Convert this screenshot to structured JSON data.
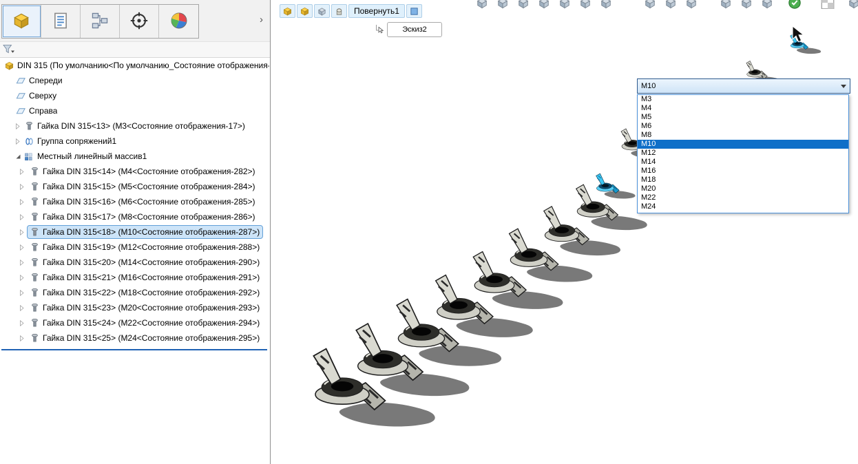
{
  "left_panel": {
    "tabs": [
      {
        "icon": "featuremanager-tree-icon"
      },
      {
        "icon": "propertymanager-icon"
      },
      {
        "icon": "configurationmanager-icon"
      },
      {
        "icon": "dimxpertmanager-icon"
      },
      {
        "icon": "displaymanager-icon"
      }
    ],
    "more_chevron": "›",
    "filter": {
      "icon": "filter-funnel-icon"
    },
    "tree": {
      "root_label": "DIN 315  (По умолчанию<По умолчанию_Состояние отображения-",
      "top_items": [
        {
          "icon": "plane-icon",
          "label": "Спереди"
        },
        {
          "icon": "plane-icon",
          "label": "Сверху"
        },
        {
          "icon": "plane-icon",
          "label": "Справа"
        },
        {
          "icon": "nut-part-icon",
          "label": "Гайка DIN 315<13>  (M3<Состояние отображения-17>)"
        },
        {
          "icon": "mates-group-icon",
          "label": "Группа сопряжений1"
        },
        {
          "icon": "linear-pattern-icon",
          "label": "Местный линейный массив1",
          "expanded": true
        }
      ],
      "pattern_children": [
        {
          "label": "Гайка DIN 315<14>  (M4<Состояние отображения-282>)"
        },
        {
          "label": "Гайка DIN 315<15>  (M5<Состояние отображения-284>)"
        },
        {
          "label": "Гайка DIN 315<16>  (M6<Состояние отображения-285>)"
        },
        {
          "label": "Гайка DIN 315<17>  (M8<Состояние отображения-286>)"
        },
        {
          "label": "Гайка DIN 315<18>  (M10<Состояние отображения-287>)",
          "selected": true
        },
        {
          "label": "Гайка DIN 315<19>  (M12<Состояние отображения-288>)"
        },
        {
          "label": "Гайка DIN 315<20>  (M14<Состояние отображения-290>)"
        },
        {
          "label": "Гайка DIN 315<21>  (M16<Состояние отображения-291>)"
        },
        {
          "label": "Гайка DIN 315<22>  (M18<Состояние отображения-292>)"
        },
        {
          "label": "Гайка DIN 315<23>  (M20<Состояние отображения-293>)"
        },
        {
          "label": "Гайка DIN 315<24>  (M22<Состояние отображения-294>)"
        },
        {
          "label": "Гайка DIN 315<25>  (M24<Состояние отображения-295>)"
        }
      ]
    }
  },
  "viewport": {
    "breadcrumb": {
      "feature_label": "Повернуть1",
      "sketch_label": "Эскиз2"
    },
    "size_dropdown": {
      "value": "M10",
      "selected": "M10",
      "options": [
        "M3",
        "M4",
        "M5",
        "M6",
        "M8",
        "M10",
        "M12",
        "M14",
        "M16",
        "M18",
        "M20",
        "M22",
        "M24"
      ]
    },
    "colors": {
      "selection_blue": "#2ea8e0",
      "tree_highlight": "#cde4f8",
      "dropdown_highlight": "#0f6fc8"
    }
  }
}
